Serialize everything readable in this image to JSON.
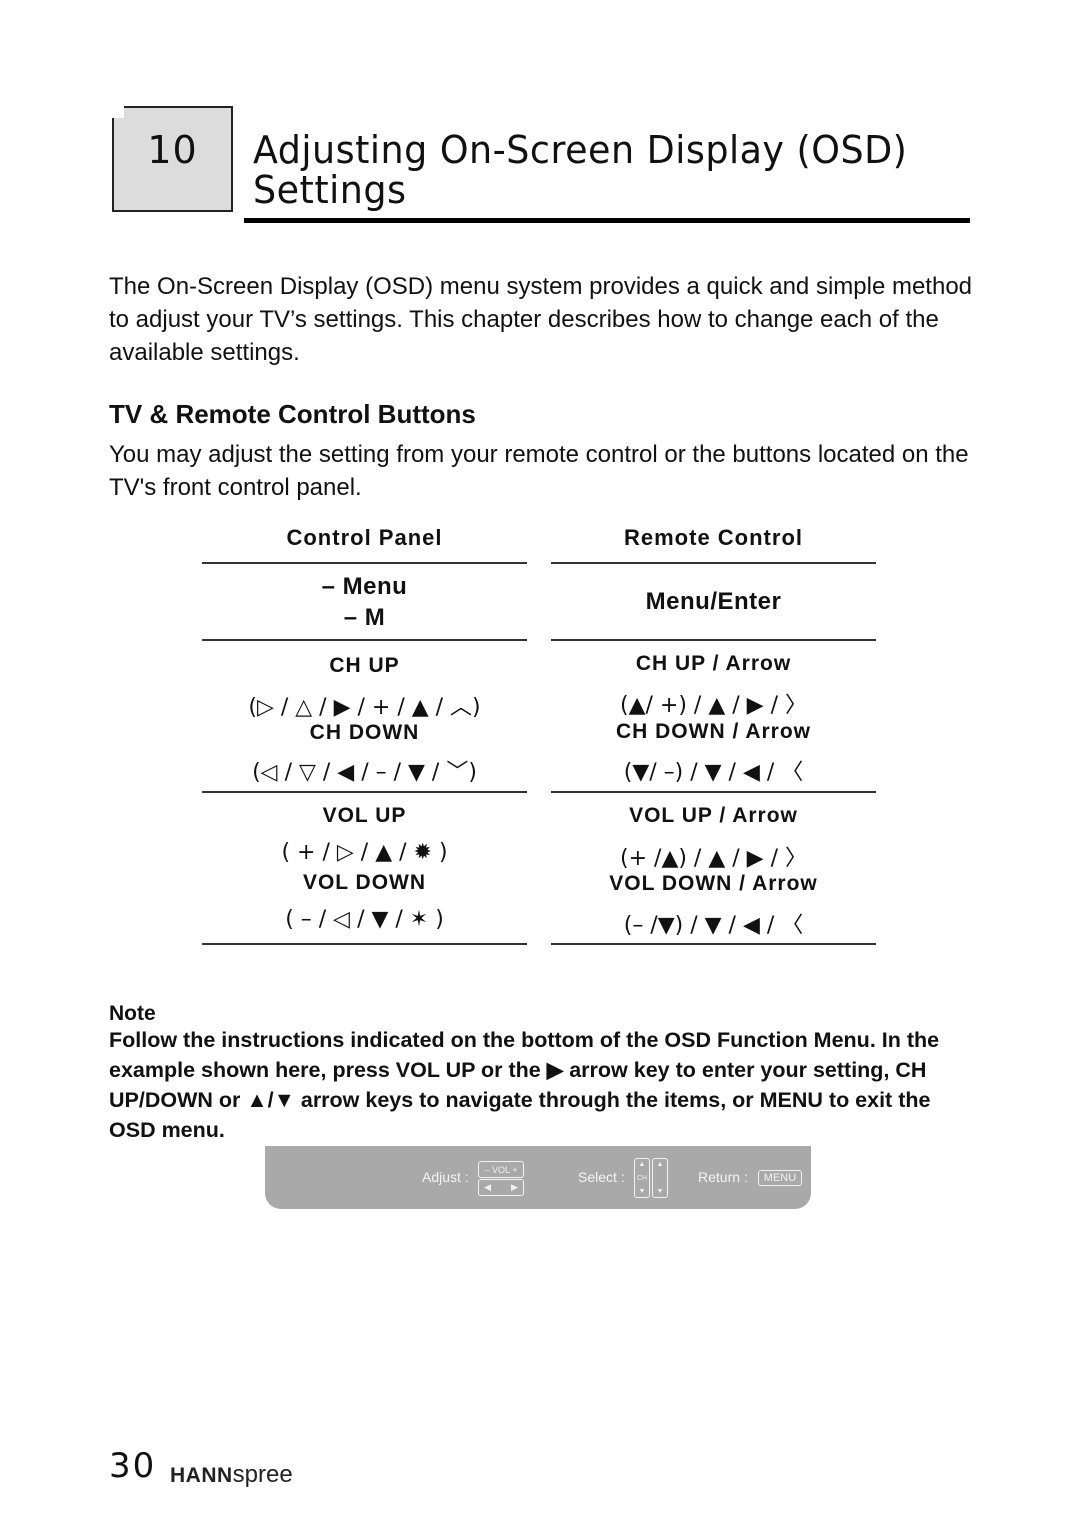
{
  "chapter": {
    "number": "10",
    "title_line1": "Adjusting On-Screen Display (OSD)",
    "title_line2": "Settings"
  },
  "intro": "The On-Screen Display (OSD) menu system provides a quick and simple method to adjust your TV’s settings. This chapter describes how to change each of the available settings.",
  "section": {
    "heading": "TV & Remote Control Buttons",
    "text": "You may adjust the setting from your remote control or the buttons located on the TV's front control panel."
  },
  "table": {
    "headers": [
      "Control Panel",
      "Remote Control"
    ],
    "menu": {
      "panel": [
        "– Menu",
        "– M"
      ],
      "remote": "Menu/Enter"
    },
    "ch": {
      "panel_up_label": "CH UP",
      "panel_up_symbols": "(▷ / △ / ▶ / + / ▲ / ︿)",
      "panel_down_label": "CH DOWN",
      "panel_down_symbols": "(◁ / ▽ / ◀ / – / ▼ / ﹀)",
      "remote_up_label": "CH UP / Arrow",
      "remote_up_symbols": "(▲/ +) / ▲ / ▶ / 〉",
      "remote_down_label": "CH DOWN / Arrow",
      "remote_down_symbols": "(▼/ –) / ▼ / ◀ / 〈"
    },
    "vol": {
      "panel_up_label": "VOL UP",
      "panel_up_symbols": "( + / ▷ / ▲ / ✹ )",
      "panel_down_label": "VOL DOWN",
      "panel_down_symbols": "( – / ◁ / ▼ / ✶ )",
      "remote_up_label": "VOL UP / Arrow",
      "remote_up_symbols": "(+ /▲) / ▲ / ▶ / 〉",
      "remote_down_label": "VOL DOWN / Arrow",
      "remote_down_symbols": "(– /▼) / ▼ / ◀ / 〈"
    }
  },
  "note": {
    "heading": "Note",
    "text": "Follow the instructions indicated on the bottom of the OSD Function Menu. In the example shown here, press VOL UP or the ▶ arrow key to enter your setting, CH UP/DOWN or ▲/▼ arrow keys to navigate through the items, or MENU to exit the OSD menu."
  },
  "osd_bar": {
    "adjust_label": "Adjust :",
    "adjust_key_top": "– VOL +",
    "adjust_key_bottom": "◀        ▶",
    "select_label": "Select :",
    "select_key": "CH",
    "return_label": "Return :",
    "return_key": "MENU"
  },
  "footer": {
    "page_number": "30",
    "brand_bold": "HANN",
    "brand_light": "spree"
  }
}
